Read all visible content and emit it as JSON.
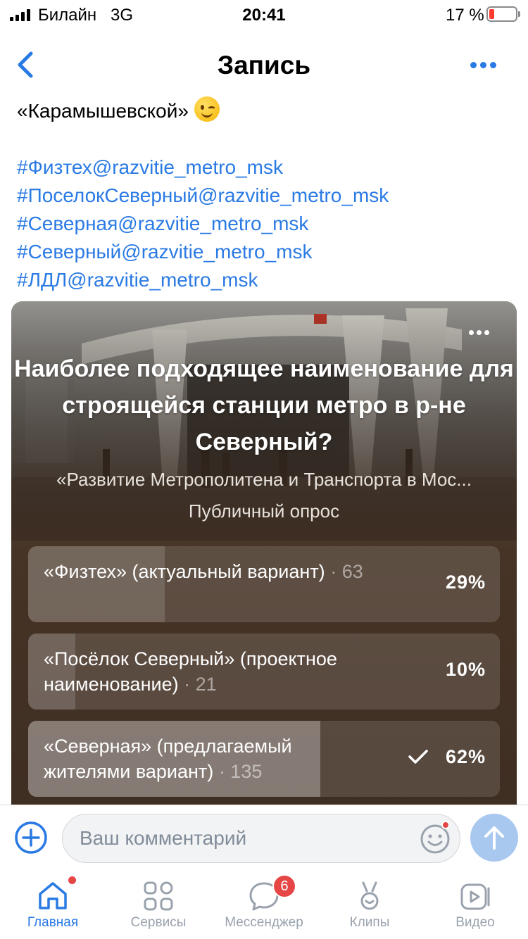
{
  "status_bar": {
    "carrier": "Билайн",
    "network": "3G",
    "time": "20:41",
    "battery_percent": "17 %",
    "battery_level": 0.17
  },
  "header": {
    "title": "Запись",
    "back_icon": "chevron-left-icon",
    "more_icon": "more-horizontal-icon"
  },
  "post": {
    "text_line": "«Карамышевской»",
    "emoji": "winking-face-emoji",
    "hashtags": [
      "#Физтех@razvitie_metro_msk",
      "#ПоселокСеверный@razvitie_metro_msk",
      "#Северная@razvitie_metro_msk",
      "#Северный@razvitie_metro_msk",
      "#ЛДЛ@razvitie_metro_msk"
    ]
  },
  "poll": {
    "question": "Наиболее подходящее наименование для строящейся станции метро в р-не Северный?",
    "author": "«Развитие Метрополитена и Транспорта в Мос...",
    "type": "Публичный опрос",
    "options": [
      {
        "text": "«Физтех» (актуальный вариант)",
        "count": "· 63",
        "percent": "29%",
        "fraction": 0.29,
        "voted": false
      },
      {
        "text": "«Посёлок Северный» (проектное наименование)",
        "count": "· 21",
        "percent": "10%",
        "fraction": 0.1,
        "voted": false
      },
      {
        "text": "«Северная» (предлагаемый жителями вариант)",
        "count": "· 135",
        "percent": "62%",
        "fraction": 0.62,
        "voted": true
      }
    ]
  },
  "comment": {
    "placeholder": "Ваш комментарий"
  },
  "tabs": [
    {
      "label": "Главная",
      "icon": "home-icon",
      "active": true,
      "badge": "dot"
    },
    {
      "label": "Сервисы",
      "icon": "services-grid-icon",
      "active": false
    },
    {
      "label": "Мессенджер",
      "icon": "messenger-icon",
      "active": false,
      "badge": "6"
    },
    {
      "label": "Клипы",
      "icon": "clips-icon",
      "active": false
    },
    {
      "label": "Видео",
      "icon": "video-icon",
      "active": false
    }
  ],
  "colors": {
    "accent": "#2a7ae4",
    "badge": "#e64646",
    "inactive": "#99a2ad"
  }
}
